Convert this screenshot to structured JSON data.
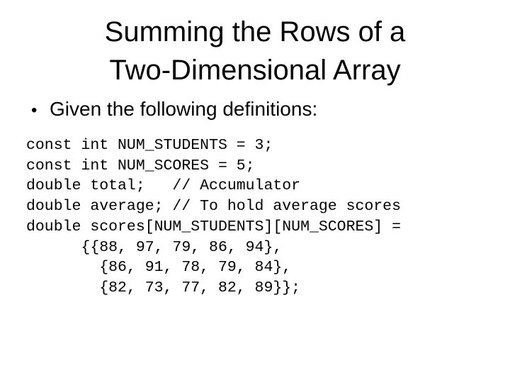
{
  "slide": {
    "title_lines": [
      "Summing the Rows of a",
      "Two-Dimensional Array"
    ],
    "bullet": {
      "icon": "bullet-dot",
      "symbol": "•",
      "text": "Given the following definitions:"
    },
    "code_lines": [
      "const int NUM_STUDENTS = 3;",
      "const int NUM_SCORES = 5;",
      "double total;   // Accumulator",
      "double average; // To hold average scores",
      "double scores[NUM_STUDENTS][NUM_SCORES] =",
      "      {{88, 97, 79, 86, 94},",
      "        {86, 91, 78, 79, 84},",
      "        {82, 73, 77, 82, 89}};"
    ]
  }
}
